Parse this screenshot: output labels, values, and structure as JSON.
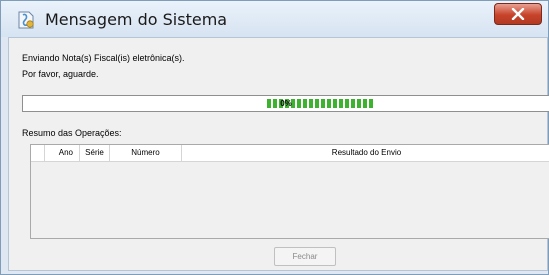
{
  "window": {
    "title": "Mensagem do Sistema",
    "close_icon": "close-icon",
    "app_icon": "certificate-icon"
  },
  "messages": {
    "line1": "Enviando Nota(s) Fiscal(is) eletrônica(s).",
    "line2": "Por favor, aguarde."
  },
  "progress": {
    "text": "0%",
    "value": 0.0,
    "fill_color": "#3cb22f"
  },
  "operations": {
    "label": "Resumo das Operações:",
    "columns": [
      "",
      "Ano",
      "Série",
      "Número",
      "Resultado do Envio"
    ],
    "rows": []
  },
  "footer": {
    "close_label": "Fechar"
  },
  "colors": {
    "close_button": "#c7432a",
    "titlebar": "#dfe8f2"
  }
}
